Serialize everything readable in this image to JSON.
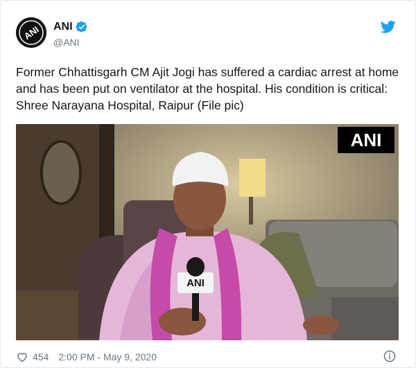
{
  "account": {
    "name": "ANI",
    "handle": "@ANI",
    "avatar_text": "ANI",
    "verified": true
  },
  "tweet": {
    "text": "Former Chhattisgarh CM Ajit Jogi has suffered a cardiac arrest at home and has been put on ventilator at the hospital. His condition is critical: Shree Narayana Hospital, Raipur (File pic)",
    "media_watermark": "ANI",
    "mic_label": "ANI"
  },
  "footer": {
    "likes": "454",
    "timestamp": "2:00 PM - May 9, 2020"
  },
  "icons": {
    "brand": "twitter-bird-icon",
    "verified": "verified-badge-icon",
    "like": "heart-icon",
    "info": "info-icon"
  },
  "colors": {
    "twitter_blue": "#1da1f2",
    "text": "#14171a",
    "muted": "#657786",
    "border": "#e1e8ed"
  }
}
